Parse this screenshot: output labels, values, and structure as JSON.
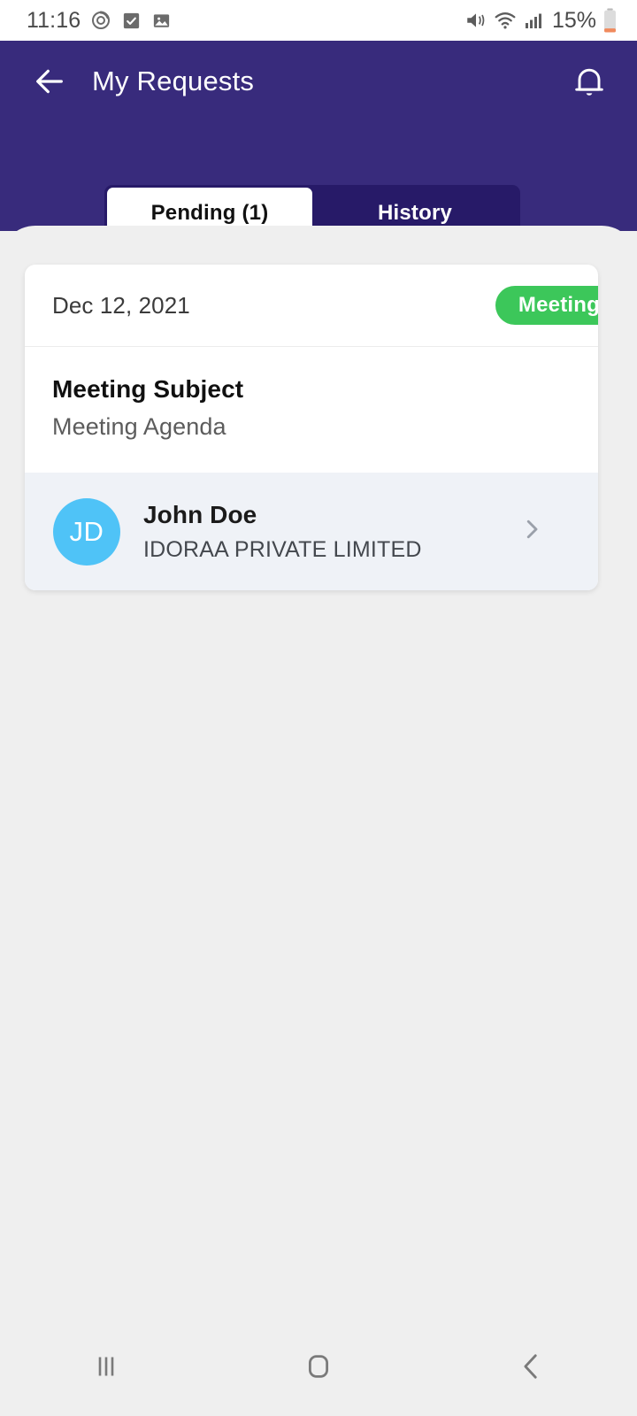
{
  "status_bar": {
    "time": "11:16",
    "battery_text": "15%",
    "left_icons": [
      "alarm-icon",
      "checkbox-icon",
      "image-icon"
    ],
    "right_icons": [
      "mute-icon",
      "wifi-icon",
      "signal-icon",
      "battery-icon"
    ]
  },
  "header": {
    "title": "My Requests",
    "back_icon": "arrow-left-icon",
    "notification_icon": "bell-icon",
    "background_color": "#382b7c"
  },
  "tabs": {
    "container_color": "#271a68",
    "items": [
      {
        "label": "Pending (1)",
        "active": true
      },
      {
        "label": "History",
        "active": false
      }
    ]
  },
  "requests": [
    {
      "date": "Dec 12, 2021",
      "badge": {
        "label": "Meeting",
        "color": "#3cc75a"
      },
      "subject": "Meeting Subject",
      "agenda": "Meeting Agenda",
      "person": {
        "initials": "JD",
        "avatar_color": "#4fc3f7",
        "name": "John Doe",
        "organization": "IDORAA PRIVATE LIMITED"
      },
      "chevron_icon": "chevron-right-icon"
    }
  ],
  "navbar": {
    "recents_icon": "recents-icon",
    "home_icon": "home-icon",
    "back_icon": "chevron-left-icon"
  }
}
